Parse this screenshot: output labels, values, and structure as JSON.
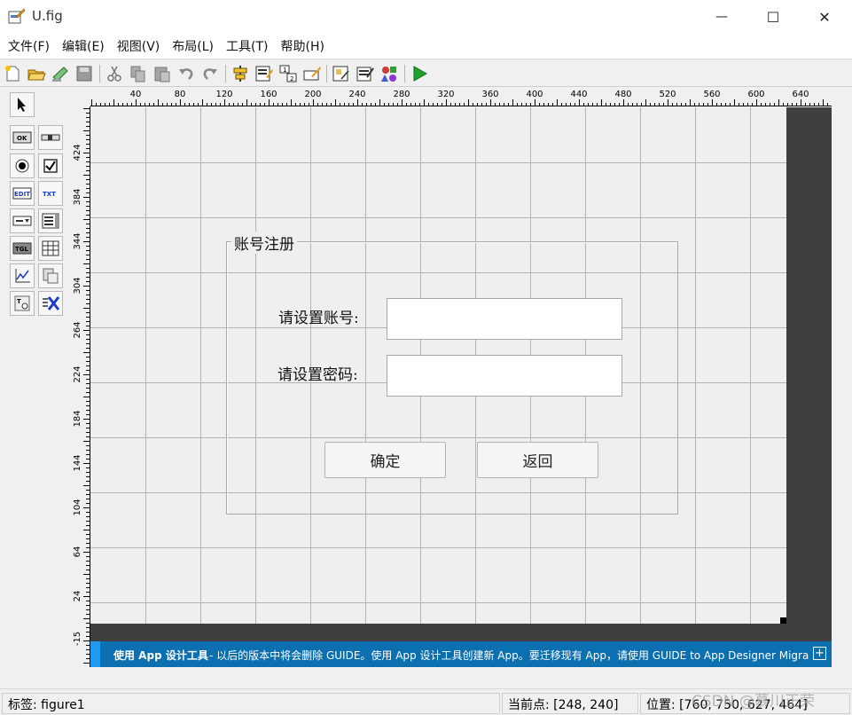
{
  "window": {
    "title": "U.fig",
    "minimize_glyph": "—",
    "maximize_glyph": "☐",
    "close_glyph": "✕"
  },
  "menu": [
    "文件(F)",
    "编辑(E)",
    "视图(V)",
    "布局(L)",
    "工具(T)",
    "帮助(H)"
  ],
  "toolbar_icons": [
    "new-icon",
    "open-icon",
    "save-icon",
    "cut-icon",
    "copy-icon",
    "paste-icon",
    "undo-icon",
    "redo-icon",
    "align-icon",
    "menu-editor-icon",
    "tab-order-icon",
    "toolbar-editor-icon",
    "editor-icon",
    "inspector-icon",
    "object-browser-icon",
    "run-icon"
  ],
  "palette_icons": [
    "select-arrow-icon",
    "push-button-icon",
    "slider-icon",
    "radio-button-icon",
    "checkbox-icon",
    "edit-text-icon",
    "static-text-icon",
    "popup-menu-icon",
    "listbox-icon",
    "toggle-button-icon",
    "table-icon",
    "axes-icon",
    "panel-icon",
    "button-group-icon",
    "activex-icon"
  ],
  "ruler": {
    "x_ticks": [
      "40",
      "80",
      "120",
      "160",
      "200",
      "240",
      "280",
      "320",
      "360",
      "400",
      "440",
      "480",
      "520",
      "560",
      "600",
      "640"
    ],
    "y_ticks": [
      "424",
      "384",
      "344",
      "304",
      "264",
      "224",
      "184",
      "144",
      "104",
      "64",
      "24",
      "-15"
    ]
  },
  "form": {
    "panel_title": "账号注册",
    "account_label": "请设置账号:",
    "account_value": "",
    "password_label": "请设置密码:",
    "password_value": "",
    "confirm_button": "确定",
    "back_button": "返回"
  },
  "banner": {
    "bold": "使用 App 设计工具",
    "text": " - 以后的版本中将会删除 GUIDE。使用 App 设计工具创建新 App。要迁移现有 App，请使用 GUIDE to App Designer Migration...",
    "expand": "+"
  },
  "status": {
    "tag": "标签: figure1",
    "current_point": "当前点:  [248, 240]",
    "position": "位置: [760, 750, 627, 464]"
  },
  "watermark": "CSDN @慕川正荣",
  "colors": {
    "banner": "#0c6fb0",
    "banner_accent": "#1e9bf0",
    "canvas": "#efefef",
    "dark_area": "#3f3f3f",
    "run_green": "#1fa32a"
  }
}
